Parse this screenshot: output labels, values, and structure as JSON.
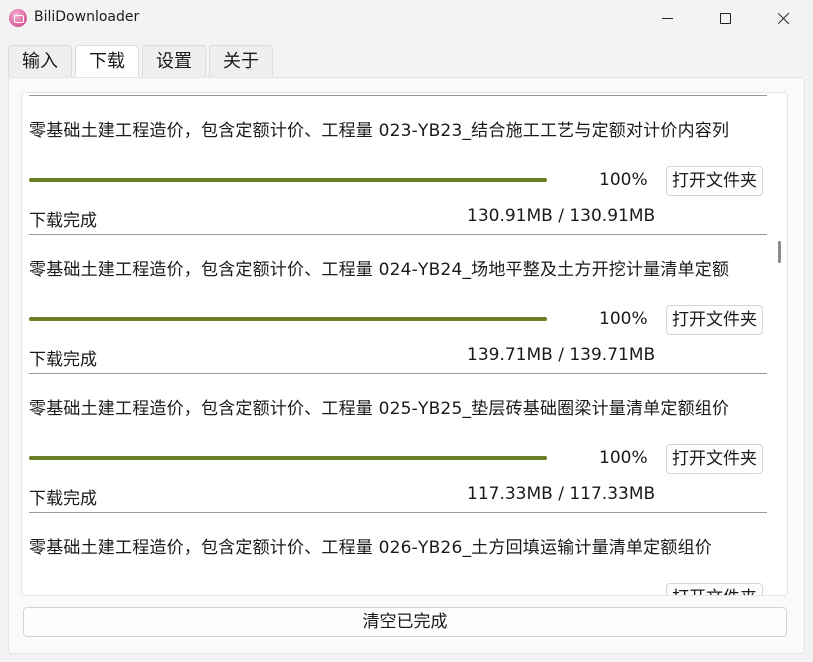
{
  "window": {
    "title": "BiliDownloader"
  },
  "tabs": [
    {
      "label": "输入"
    },
    {
      "label": "下载"
    },
    {
      "label": "设置"
    },
    {
      "label": "关于"
    }
  ],
  "downloads": {
    "open_folder_label": "打开文件夹",
    "items": [
      {
        "title": "",
        "percent": "",
        "progress": 1.0,
        "status": "",
        "size": "",
        "partial": true
      },
      {
        "title": "零基础土建工程造价，包含定额计价、工程量 023-YB23_结合施工工艺与定额对计价内容列",
        "percent": "100%",
        "progress": 1.0,
        "status": "下载完成",
        "size": "130.91MB / 130.91MB"
      },
      {
        "title": "零基础土建工程造价，包含定额计价、工程量 024-YB24_场地平整及土方开挖计量清单定额",
        "percent": "100%",
        "progress": 1.0,
        "status": "下载完成",
        "size": "139.71MB / 139.71MB"
      },
      {
        "title": "零基础土建工程造价，包含定额计价、工程量 025-YB25_垫层砖基础圈梁计量清单定额组价",
        "percent": "100%",
        "progress": 1.0,
        "status": "下载完成",
        "size": "117.33MB / 117.33MB"
      },
      {
        "title": "零基础土建工程造价，包含定额计价、工程量 026-YB26_土方回填运输计量清单定额组价",
        "percent": "",
        "progress": 1.0,
        "status": "",
        "size": ""
      }
    ]
  },
  "footer": {
    "clear_label": "清空已完成"
  },
  "colors": {
    "progress": "#6a7d27",
    "background": "#f3f3f3"
  }
}
